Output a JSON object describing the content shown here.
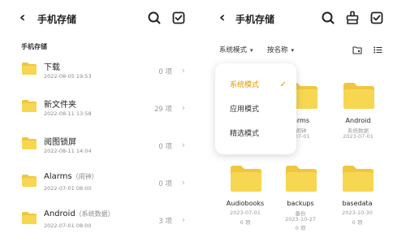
{
  "left": {
    "header": {
      "back_glyph": "‹",
      "title": "手机存储",
      "icons": [
        "search-icon",
        "select-all-icon"
      ]
    },
    "section_label": "手机存储",
    "items": [
      {
        "name": "下载",
        "sub": "",
        "date": "2022-08-05 19:53",
        "count": "0 项"
      },
      {
        "name": "新文件夹",
        "sub": "",
        "date": "2022-08-11 13:58",
        "count": "29 项"
      },
      {
        "name": "阅图锁屏",
        "sub": "",
        "date": "2022-08-11 14:04",
        "count": "0 项"
      },
      {
        "name": "Alarms",
        "sub": "（闹钟）",
        "date": "2022-07-01 08:00",
        "count": "0 项"
      },
      {
        "name": "Android",
        "sub": "（系统数据）",
        "date": "2022-07-01 08:00",
        "count": "3 项"
      }
    ],
    "chevron_glyph": "›"
  },
  "right": {
    "header": {
      "back_glyph": "‹",
      "title": "手机存储",
      "icons": [
        "search-icon",
        "cleanup-icon",
        "select-all-icon"
      ]
    },
    "sort": {
      "mode_label": "系统模式",
      "name_label": "按名称",
      "caret": "▾",
      "icons": [
        "new-folder-icon",
        "list-view-icon"
      ]
    },
    "grid": [
      {
        "name": "arms",
        "sub": "闹钟",
        "date": "-07-01"
      },
      {
        "name": "Android",
        "sub": "系统数据",
        "date": "2023-07-01"
      },
      {
        "name": "Audiobooks",
        "sub": "",
        "date": "2023-07-01"
      },
      {
        "name": "backups",
        "sub": "备份",
        "date": "2023-10-27"
      },
      {
        "name": "basedata",
        "sub": "",
        "date": "2023-10-30"
      }
    ],
    "footer_counts": [
      "0 项",
      "0 项",
      "0 项"
    ],
    "menu": {
      "items": [
        {
          "label": "系统模式",
          "selected": true
        },
        {
          "label": "应用模式",
          "selected": false
        },
        {
          "label": "精选模式",
          "selected": false
        }
      ],
      "check_glyph": "✓"
    }
  },
  "colors": {
    "folder": "#f7d652",
    "folder_tab": "#f0c63f",
    "accent": "#e09a00",
    "muted": "#8a8a8a"
  }
}
